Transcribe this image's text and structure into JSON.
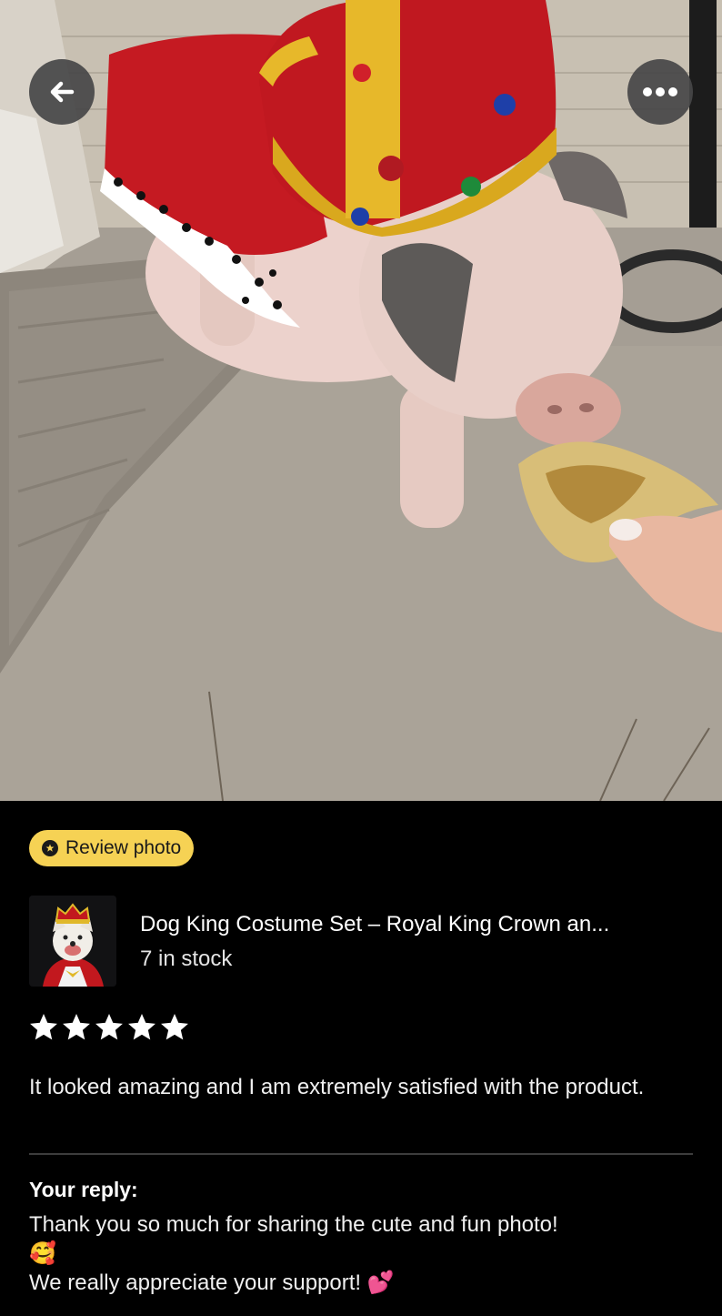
{
  "nav": {
    "back_icon": "arrow-left-icon",
    "more_icon": "ellipsis-icon"
  },
  "review": {
    "badge_label": "Review photo",
    "badge_icon": "star-in-circle-icon",
    "product_title": "Dog King Costume Set – Royal King Crown an...",
    "stock": "7 in stock",
    "rating": 5,
    "rating_max": 5,
    "text": "It looked amazing and I am extremely satisfied with the product."
  },
  "reply": {
    "label": "Your reply:",
    "line1": "Thank you so much for sharing the cute and fun photo!",
    "emoji1": "🥰",
    "line2": "We really appreciate your support!",
    "emoji2": "💕"
  },
  "colors": {
    "badge_bg": "#f6d254",
    "panel_bg": "#000000",
    "overlay_button": "#464648"
  }
}
